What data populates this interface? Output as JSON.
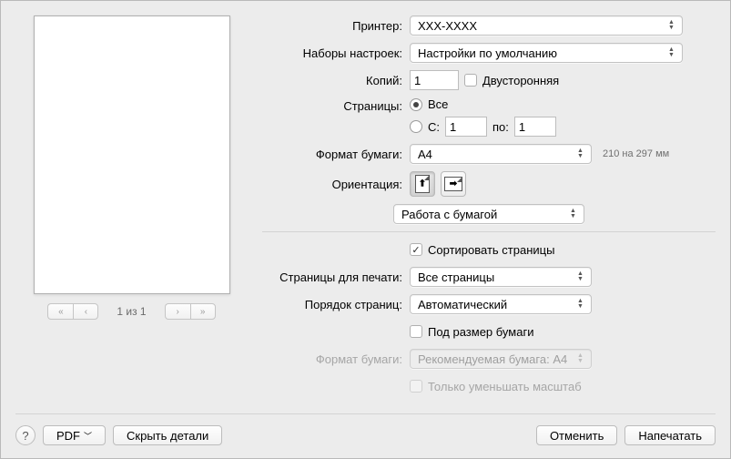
{
  "labels": {
    "printer": "Принтер:",
    "presets": "Наборы настроек:",
    "copies": "Копий:",
    "two_sided": "Двусторонняя",
    "pages": "Страницы:",
    "all": "Все",
    "from": "С:",
    "to": "по:",
    "paper_size": "Формат бумаги:",
    "orientation": "Ориентация:",
    "section": "Работа с бумагой",
    "collate": "Сортировать страницы",
    "pages_to_print": "Страницы для печати:",
    "page_order": "Порядок страниц:",
    "fit_to_paper": "Под размер бумаги",
    "paper_size2": "Формат бумаги:",
    "scale_down_only": "Только уменьшать масштаб",
    "pdf": "PDF",
    "hide_details": "Скрыть детали",
    "cancel": "Отменить",
    "print": "Напечатать"
  },
  "values": {
    "printer": "XXX-XXXX",
    "preset": "Настройки по умолчанию",
    "copies": "1",
    "pages_from": "1",
    "pages_to": "1",
    "paper_size": "A4",
    "paper_hint": "210 на 297 мм",
    "pages_to_print": "Все страницы",
    "page_order": "Автоматический",
    "dest_paper": "Рекомендуемая бумага: A4"
  },
  "state": {
    "pages_mode": "all",
    "two_sided_checked": false,
    "collate_checked": true,
    "fit_checked": false,
    "scale_down_checked": false,
    "orientation": "portrait"
  },
  "preview": {
    "page_indicator": "1 из 1"
  }
}
